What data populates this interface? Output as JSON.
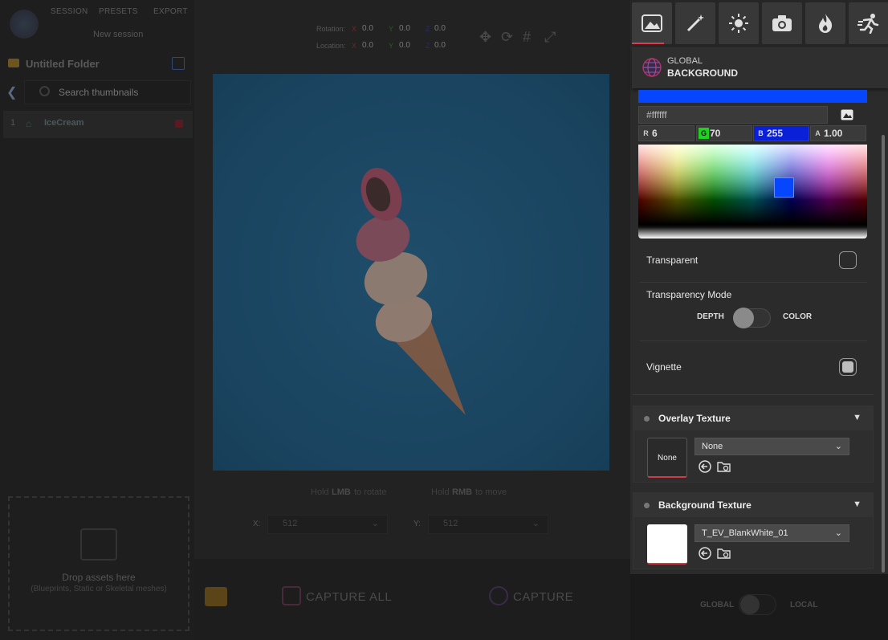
{
  "background_app": {
    "menu": [
      "SESSION",
      "PRESETS",
      "EXPORT"
    ],
    "session_name": "New session",
    "folder_name": "Untitled Folder",
    "search_placeholder": "Search thumbnails",
    "list_item": {
      "index": "1",
      "name": "IceCream"
    },
    "transform": {
      "rotation_label": "Rotation:",
      "location_label": "Location:",
      "axis_labels": [
        "X",
        "Y",
        "Z"
      ],
      "rotation": [
        "0.0",
        "0.0",
        "0.0"
      ],
      "location": [
        "0.0",
        "0.0",
        "0.0"
      ]
    },
    "hints": {
      "rotate_pre": "Hold",
      "rotate_key": "LMB",
      "rotate_post": "to rotate",
      "move_pre": "Hold",
      "move_key": "RMB",
      "move_post": "to move"
    },
    "coords": {
      "x_label": "X:",
      "x_value": "512",
      "y_label": "Y:",
      "y_value": "512"
    },
    "dropzone": {
      "title": "Drop assets here",
      "subtitle": "(Blueprints, Static or Skeletal meshes)"
    },
    "capture_all": "CAPTURE ALL",
    "capture": "CAPTURE",
    "scope_switch": {
      "left": "GLOBAL",
      "right": "LOCAL"
    }
  },
  "panel": {
    "tabs": [
      "image-icon",
      "magic-wand-icon",
      "sun-icon",
      "camera-icon",
      "fire-icon",
      "runner-icon"
    ],
    "header_top": "GLOBAL",
    "header_bottom": "BACKGROUND",
    "color": {
      "hex": "#ffffff",
      "r_label": "R",
      "r": "6",
      "g_label": "G",
      "g": "70",
      "b_label": "B",
      "b": "255",
      "a_label": "A",
      "a": "1.00",
      "swatch": "#0646ff"
    },
    "transparent_label": "Transparent",
    "transparency_mode_label": "Transparency Mode",
    "mode_left": "DEPTH",
    "mode_right": "COLOR",
    "vignette_label": "Vignette",
    "overlay": {
      "title": "Overlay Texture",
      "thumb_label": "None",
      "dropdown": "None"
    },
    "background": {
      "title": "Background Texture",
      "dropdown": "T_EV_BlankWhite_01"
    }
  }
}
